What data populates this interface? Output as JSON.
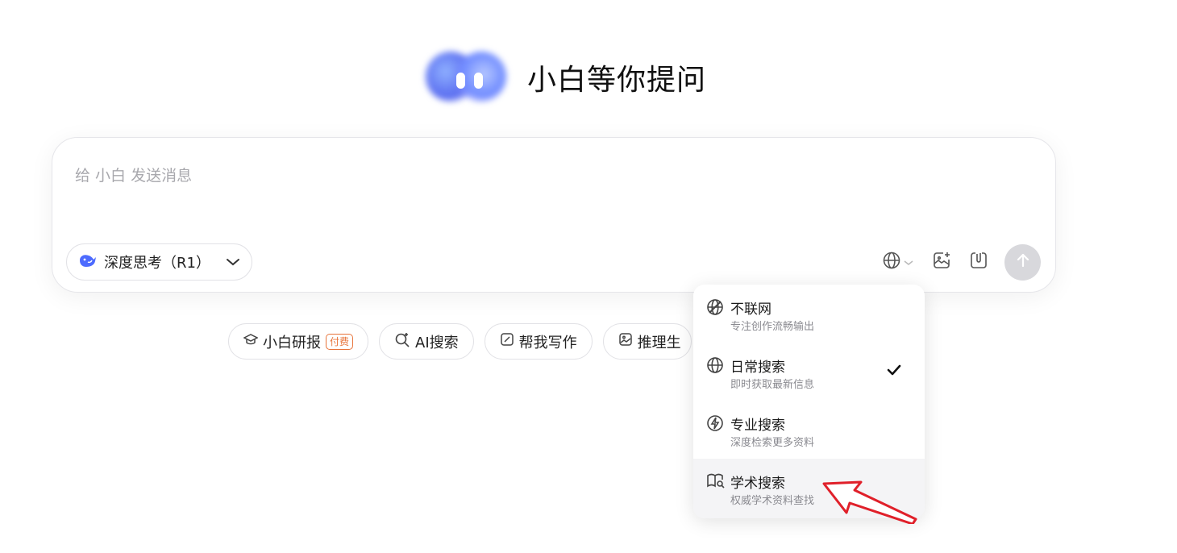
{
  "hero": {
    "title": "小白等你提问"
  },
  "composer": {
    "placeholder": "给 小白 发送消息",
    "model_label": "深度思考（R1）"
  },
  "chips": [
    {
      "label": "小白研报",
      "badge": "付费"
    },
    {
      "label": "AI搜索"
    },
    {
      "label": "帮我写作"
    },
    {
      "label": "推理生"
    }
  ],
  "search_menu": {
    "items": [
      {
        "title": "不联网",
        "desc": "专注创作流畅输出",
        "icon": "no-globe-icon"
      },
      {
        "title": "日常搜索",
        "desc": "即时获取最新信息",
        "icon": "globe-icon",
        "selected": true
      },
      {
        "title": "专业搜索",
        "desc": "深度检索更多资料",
        "icon": "lightning-circle-icon"
      },
      {
        "title": "学术搜索",
        "desc": "权威学术资料查找",
        "icon": "book-search-icon",
        "hovered": true
      }
    ]
  },
  "colors": {
    "accent": "#5a6df0",
    "badge": "#e8743b",
    "annotation_arrow": "#e0202a"
  }
}
